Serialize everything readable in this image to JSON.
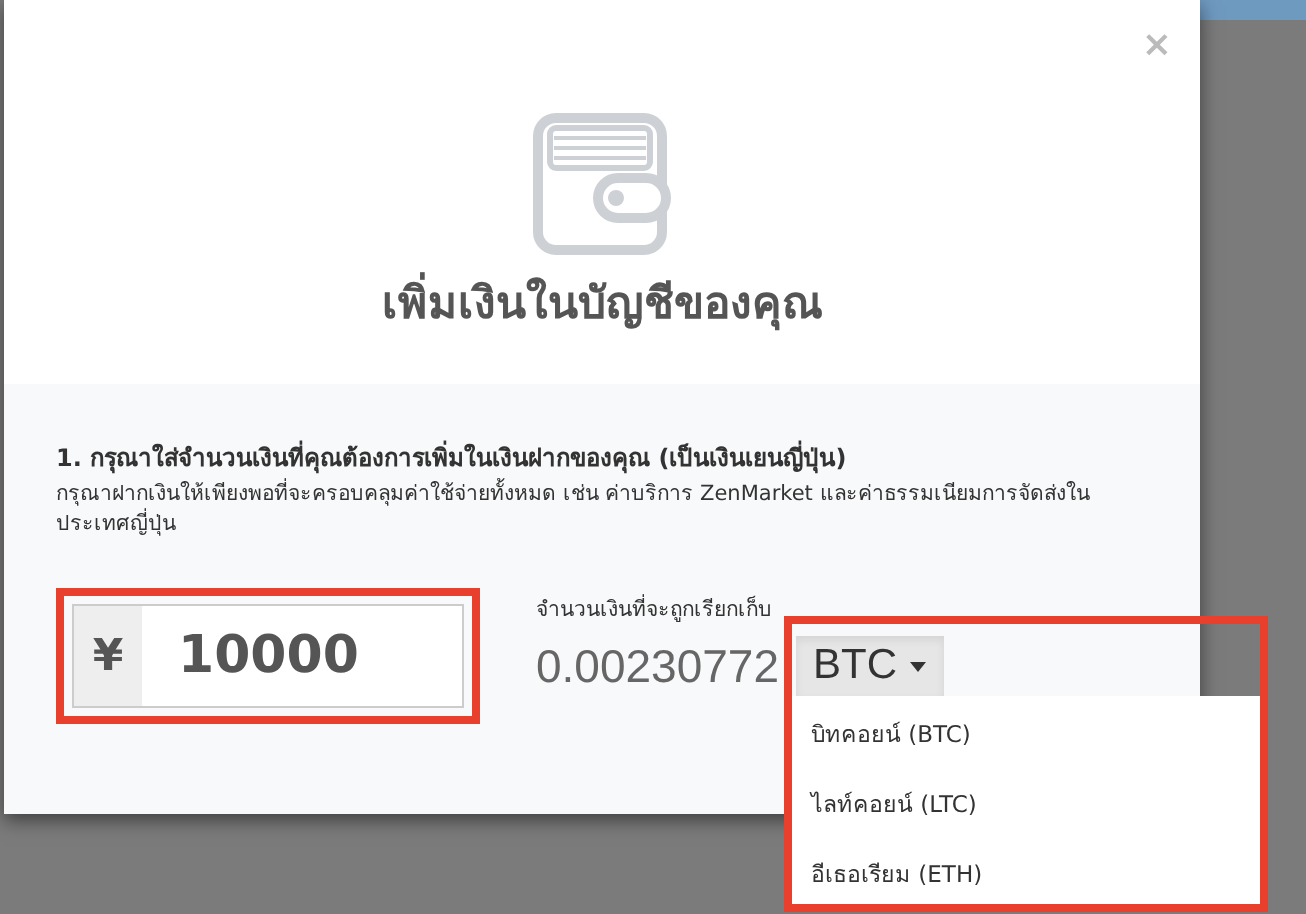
{
  "modal": {
    "close": "×",
    "title": "เพิ่มเงินในบัญชีของคุณ",
    "step": {
      "heading": "1. กรุณาใส่จำนวนเงินที่คุณต้องการเพิ่มในเงินฝากของคุณ (เป็นเงินเยนญี่ปุ่น)",
      "note": "กรุณาฝากเงินให้เพียงพอที่จะครอบคลุมค่าใช้จ่ายทั้งหมด เช่น ค่าบริการ ZenMarket และค่าธรรมเนียมการจัดส่งในประเทศญี่ปุ่น"
    },
    "amount": {
      "prefix": "¥",
      "value": "10000",
      "highlighted": true
    },
    "charge": {
      "label": "จำนวนเงินที่จะถูกเรียกเก็บ",
      "value": "0.00230772",
      "currency": "BTC",
      "expanded": true,
      "highlighted": true,
      "options": [
        {
          "label": "บิทคอยน์ (BTC)"
        },
        {
          "label": "ไลท์คอยน์ (LTC)"
        },
        {
          "label": "อีเธอเรียม (ETH)"
        }
      ]
    }
  }
}
